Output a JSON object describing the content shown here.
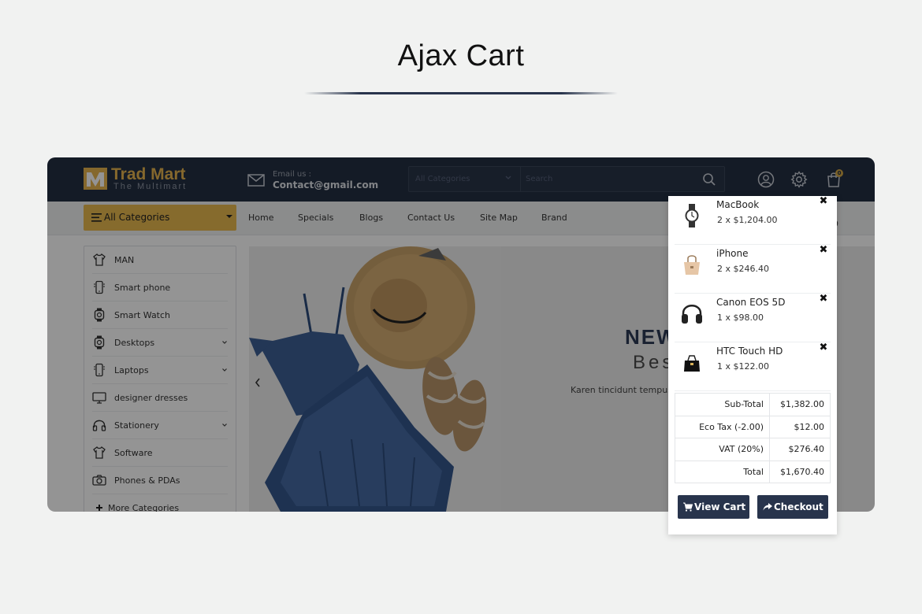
{
  "page_heading": "Ajax Cart",
  "header": {
    "logo_title": "Trad Mart",
    "logo_subtitle": "The Multimart",
    "contact_label": "Email us :",
    "contact_value": "Contact@gmail.com",
    "search_category": "All Categories",
    "search_placeholder": "Search",
    "cart_count": "0",
    "icons": [
      "user-icon",
      "gear-icon",
      "shopping-bag-icon"
    ]
  },
  "navbar": {
    "all_categories": "All Categories",
    "links": [
      "Home",
      "Specials",
      "Blogs",
      "Contact Us",
      "Site Map",
      "Brand"
    ],
    "extra": "9"
  },
  "sidebar": {
    "items": [
      {
        "label": "MAN",
        "icon": "shirt-icon",
        "has_submenu": false
      },
      {
        "label": "Smart phone",
        "icon": "smartphone-icon",
        "has_submenu": false
      },
      {
        "label": "Smart Watch",
        "icon": "watch-icon",
        "has_submenu": false
      },
      {
        "label": "Desktops",
        "icon": "watch-icon",
        "has_submenu": true
      },
      {
        "label": "Laptops",
        "icon": "smartphone-icon",
        "has_submenu": true
      },
      {
        "label": "designer dresses",
        "icon": "monitor-icon",
        "has_submenu": false
      },
      {
        "label": "Stationery",
        "icon": "headphones-icon",
        "has_submenu": true
      },
      {
        "label": "Software",
        "icon": "shirt-icon",
        "has_submenu": false
      },
      {
        "label": "Phones & PDAs",
        "icon": "camera-icon",
        "has_submenu": false
      },
      {
        "label": "More Categories",
        "icon": "plus-icon",
        "has_submenu": false
      }
    ]
  },
  "banner": {
    "title": "NEW",
    "subtitle": "Best",
    "text": "Karen tincidunt tempus v"
  },
  "cart": {
    "items": [
      {
        "name": "MacBook",
        "qty_price": "2 x $1,204.00",
        "icon": "watch-icon"
      },
      {
        "name": "iPhone",
        "qty_price": "2 x $246.40",
        "icon": "handbag-icon"
      },
      {
        "name": "Canon EOS 5D",
        "qty_price": "1 x $98.00",
        "icon": "headphones-icon"
      },
      {
        "name": "HTC Touch HD",
        "qty_price": "1 x $122.00",
        "icon": "purse-icon"
      }
    ],
    "remove_glyph": "✖",
    "totals": [
      {
        "label": "Sub-Total",
        "value": "$1,382.00"
      },
      {
        "label": "Eco Tax (-2.00)",
        "value": "$12.00"
      },
      {
        "label": "VAT (20%)",
        "value": "$276.40"
      },
      {
        "label": "Total",
        "value": "$1,670.40"
      }
    ],
    "view_cart_label": "View Cart",
    "checkout_label": "Checkout"
  },
  "colors": {
    "header_bg": "#242f42",
    "accent_gold": "#e7b84f",
    "button_bg": "#28344c"
  }
}
